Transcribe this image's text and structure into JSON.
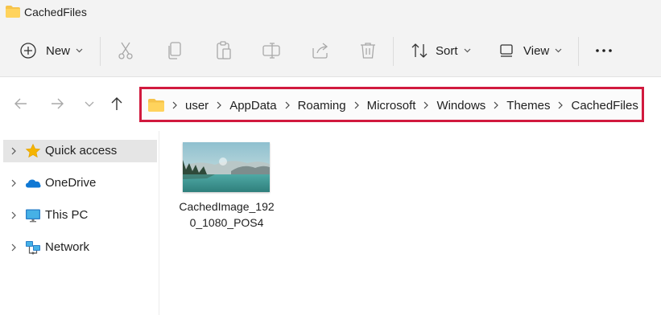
{
  "window": {
    "title": "CachedFiles"
  },
  "toolbar": {
    "new_label": "New",
    "sort_label": "Sort",
    "view_label": "View",
    "icons": [
      "plus-circle-icon",
      "cut-icon",
      "copy-icon",
      "paste-icon",
      "rename-icon",
      "share-icon",
      "delete-icon",
      "sort-icon",
      "view-icon",
      "more-icon"
    ]
  },
  "address": {
    "crumbs": [
      "user",
      "AppData",
      "Roaming",
      "Microsoft",
      "Windows",
      "Themes",
      "CachedFiles"
    ],
    "highlight_color": "#d11a3e"
  },
  "sidebar": {
    "items": [
      {
        "label": "Quick access",
        "icon": "star-icon",
        "selected": true
      },
      {
        "label": "OneDrive",
        "icon": "cloud-icon",
        "selected": false
      },
      {
        "label": "This PC",
        "icon": "monitor-icon",
        "selected": false
      },
      {
        "label": "Network",
        "icon": "network-icon",
        "selected": false
      }
    ]
  },
  "files": [
    {
      "name": "CachedImage_1920_1080_POS4"
    }
  ],
  "colors": {
    "folder": "#f6c34a",
    "accent": "#0067c0"
  }
}
